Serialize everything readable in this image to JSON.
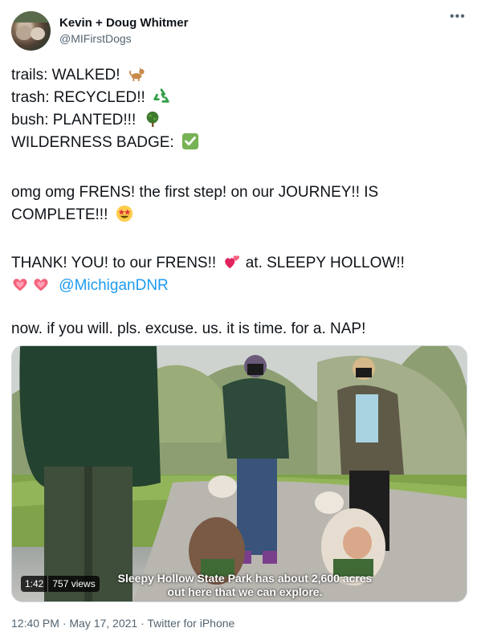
{
  "author": {
    "name": "Kevin + Doug Whitmer",
    "handle": "@MIFirstDogs"
  },
  "tweet": {
    "line1": "trails: WALKED!",
    "line2": "trash: RECYCLED!!",
    "line3": "bush: PLANTED!!!",
    "line4": "WILDERNESS BADGE:",
    "line5": "omg omg FRENS! the first step! on our JOURNEY!! IS",
    "line6": "COMPLETE!!!",
    "line7a": "THANK! YOU! to our FRENS!!",
    "line7b": "at. SLEEPY HOLLOW!!",
    "mention": "@MichiganDNR",
    "line9": "now. if you will. pls. excuse. us. it is time. for a. NAP!"
  },
  "icons": {
    "dog": "dog-icon",
    "recycle": "recycle-icon",
    "tree": "tree-icon",
    "check": "check-mark-button-icon",
    "star_eyes": "star-struck-icon",
    "hearts": "two-hearts-icon",
    "heart": "heart-icon"
  },
  "video": {
    "duration": "1:42",
    "views": "757 views",
    "caption_line1": "Sleepy Hollow State Park has about 2,600 acres",
    "caption_line2": "out here that we can explore."
  },
  "meta": {
    "timestamp": "12:40 PM · May 17, 2021 · Twitter for iPhone"
  },
  "colors": {
    "link": "#1d9bf0",
    "secondary_text": "#536471",
    "check_green": "#77b255"
  }
}
